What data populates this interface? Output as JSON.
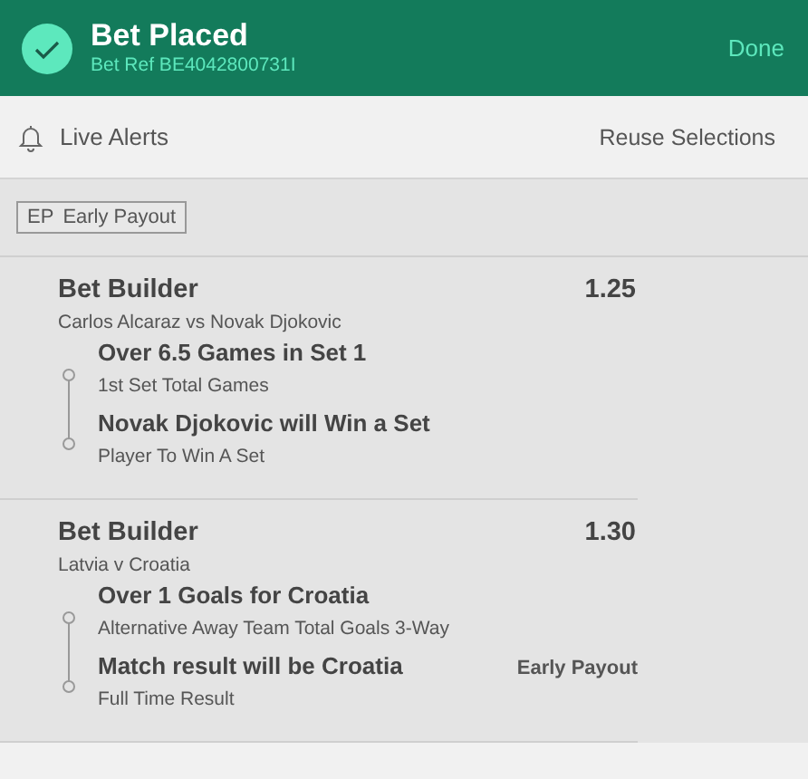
{
  "header": {
    "title": "Bet Placed",
    "bet_ref": "Bet Ref BE4042800731I",
    "done": "Done"
  },
  "toolbar": {
    "live_alerts": "Live Alerts",
    "reuse": "Reuse Selections"
  },
  "filter_badge": {
    "code": "EP",
    "label": "Early Payout"
  },
  "bets": [
    {
      "title": "Bet Builder",
      "odds": "1.25",
      "event": "Carlos Alcaraz vs Novak Djokovic",
      "legs": [
        {
          "selection": "Over 6.5 Games in Set 1",
          "market": "1st Set Total Games"
        },
        {
          "selection": "Novak Djokovic will Win a Set",
          "market": "Player To Win A Set"
        }
      ]
    },
    {
      "title": "Bet Builder",
      "odds": "1.30",
      "event": "Latvia v Croatia",
      "legs": [
        {
          "selection": "Over 1 Goals for Croatia",
          "market": "Alternative Away Team Total Goals 3-Way"
        },
        {
          "selection": "Match result will be Croatia",
          "market": "Full Time Result",
          "tag": "Early Payout"
        }
      ]
    }
  ]
}
